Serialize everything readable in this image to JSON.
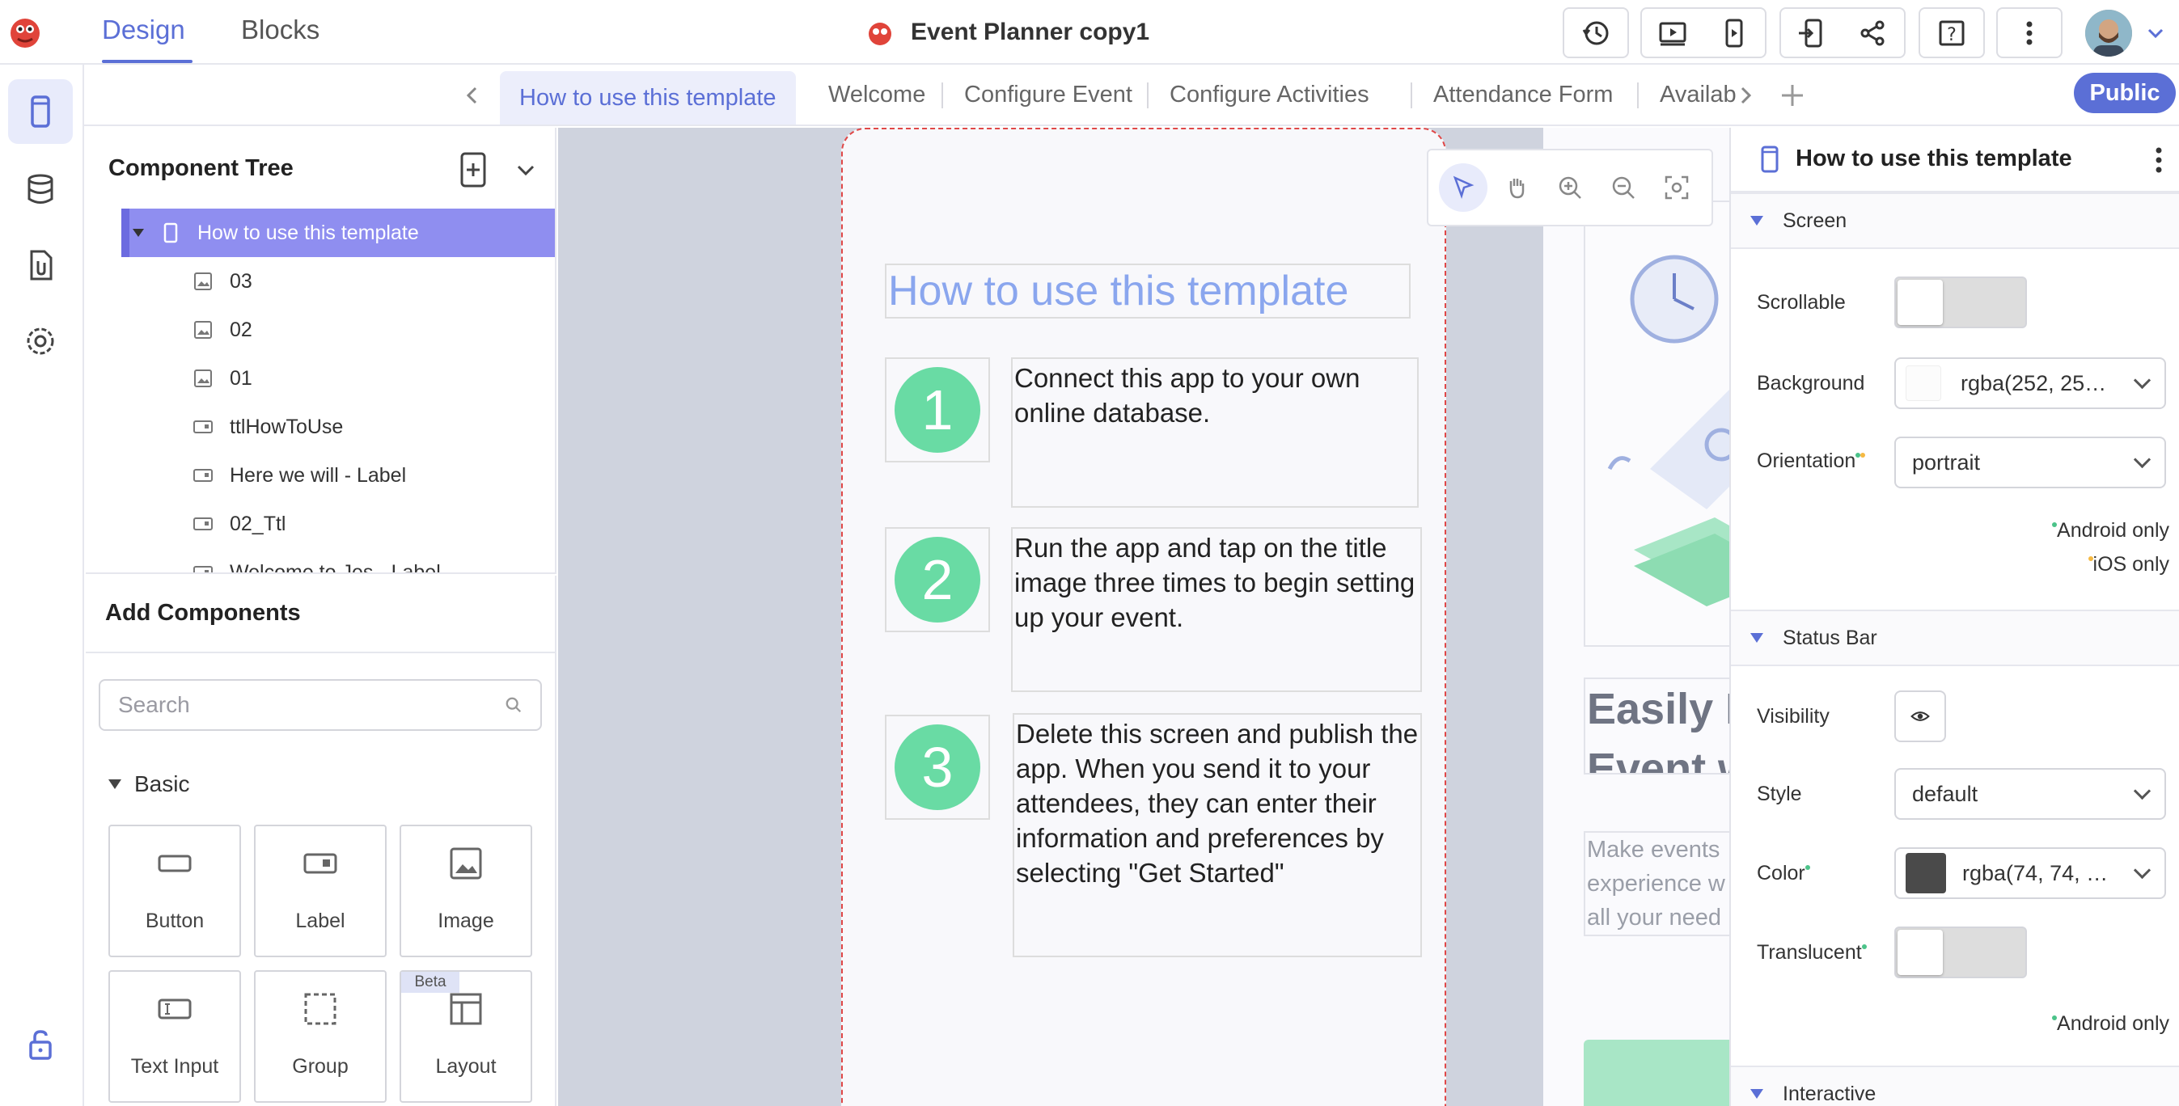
{
  "header": {
    "tabs": [
      {
        "label": "Design"
      },
      {
        "label": "Blocks"
      }
    ],
    "project_title": "Event Planner copy1",
    "icons": [
      "app-logo-icon",
      "history-icon",
      "preview-icon",
      "phone-preview-icon",
      "import-icon",
      "share-icon",
      "help-icon",
      "more-icon",
      "avatar",
      "chevron-down-icon"
    ]
  },
  "rail": {
    "items": [
      "screens-icon",
      "database-icon",
      "assets-icon",
      "settings-icon",
      "lock-icon"
    ]
  },
  "screen_tabs": {
    "tabs": [
      "How to use this template",
      "Welcome",
      "Configure Event",
      "Configure Activities",
      "Attendance Form",
      "Availab"
    ],
    "public_label": "Public"
  },
  "component_tree": {
    "title": "Component Tree",
    "items": [
      {
        "label": "How to use this template",
        "type": "screen"
      },
      {
        "label": "03",
        "type": "image"
      },
      {
        "label": "02",
        "type": "image"
      },
      {
        "label": "01",
        "type": "image"
      },
      {
        "label": "ttlHowToUse",
        "type": "label"
      },
      {
        "label": "Here we will - Label",
        "type": "label"
      },
      {
        "label": "02_Ttl",
        "type": "label"
      },
      {
        "label": "Welcome to Jes - Label",
        "type": "label"
      }
    ]
  },
  "add_components": {
    "title": "Add Components",
    "search_placeholder": "Search",
    "section": "Basic",
    "items": [
      {
        "label": "Button"
      },
      {
        "label": "Label"
      },
      {
        "label": "Image"
      },
      {
        "label": "Text Input"
      },
      {
        "label": "Group"
      },
      {
        "label": "Layout",
        "badge": "Beta"
      }
    ]
  },
  "phone": {
    "title": "How to use this template",
    "steps": [
      {
        "num": "1",
        "text": "Connect this app to your own online database."
      },
      {
        "num": "2",
        "text": "Run the app and tap on the title image three times to begin setting up your event."
      },
      {
        "num": "3",
        "text": "Delete this screen and publish the app. When you send it to your attendees, they can enter their information and preferences by selecting \"Get Started\""
      }
    ]
  },
  "right_preview": {
    "heading_line1": "Easily P",
    "heading_line2": "Event w",
    "body_lines": [
      "Make events",
      "experience w",
      "all your need"
    ]
  },
  "properties": {
    "title": "How to use this template",
    "sections": {
      "screen": "Screen",
      "status_bar": "Status Bar",
      "interactive": "Interactive"
    },
    "screen": {
      "scrollable_label": "Scrollable",
      "background_label": "Background",
      "background_value": "rgba(252, 25…",
      "orientation_label": "Orientation",
      "orientation_value": "portrait",
      "android_note": "Android only",
      "ios_note": "iOS only"
    },
    "status_bar": {
      "visibility_label": "Visibility",
      "style_label": "Style",
      "style_value": "default",
      "color_label": "Color",
      "color_value": "rgba(74, 74, …",
      "translucent_label": "Translucent",
      "android_note": "Android only"
    }
  },
  "colors": {
    "accent": "#5b6fd6",
    "selected_row": "#8f8ef0",
    "step_circle": "#69dba4",
    "android_dot": "#4cc38a",
    "ios_dot": "#f5b942",
    "status_color_swatch": "#4a4a4a"
  }
}
